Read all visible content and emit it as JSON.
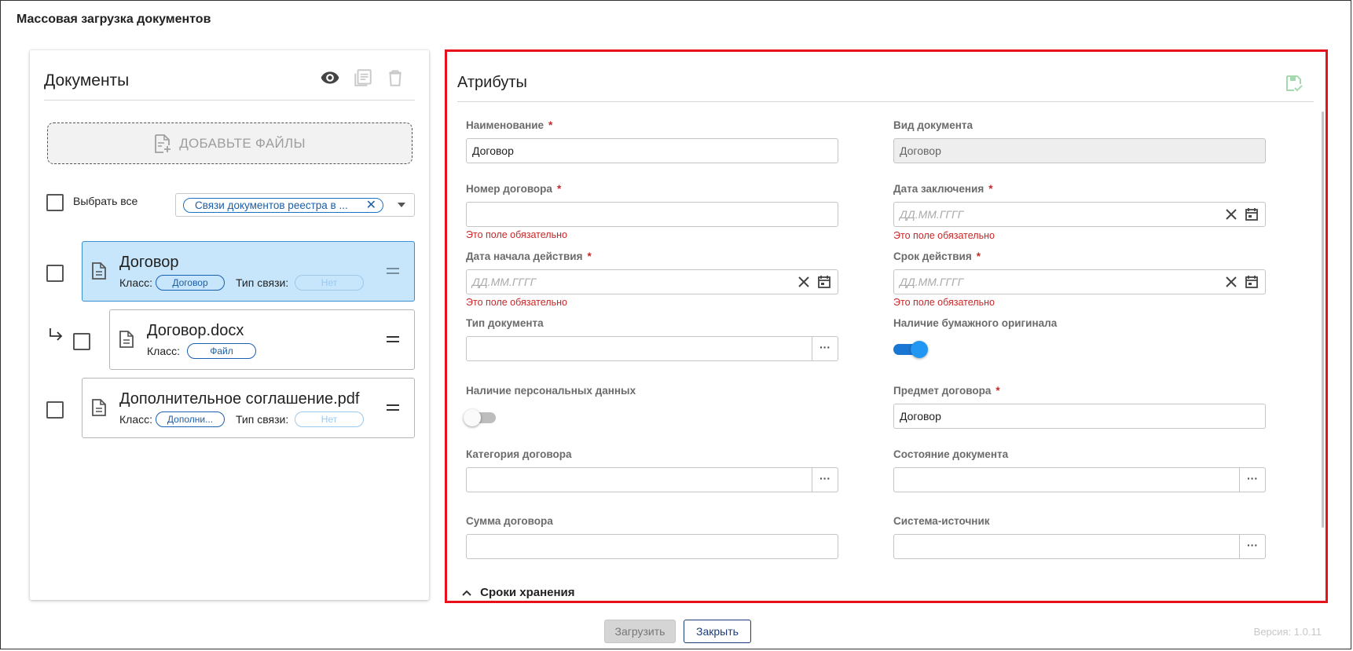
{
  "window": {
    "title": "Массовая загрузка документов"
  },
  "documents": {
    "title": "Документы",
    "add_files_label": "ДОБАВЬТЕ ФАЙЛЫ",
    "select_all_label": "Выбрать все",
    "filter_chip": "Связи документов реестра в ...",
    "items": [
      {
        "name": "Договор",
        "class_label": "Класс:",
        "class_value": "Договор",
        "link_label": "Тип связи:",
        "link_value": "Нет",
        "selected": true
      },
      {
        "name": "Договор.docx",
        "class_label": "Класс:",
        "class_value": "Файл"
      },
      {
        "name": "Дополнительное соглашение.pdf",
        "class_label": "Класс:",
        "class_value": "Дополни...",
        "link_label": "Тип связи:",
        "link_value": "Нет"
      }
    ]
  },
  "attributes": {
    "title": "Атрибуты",
    "required_mark": "*",
    "fields": {
      "name": {
        "label": "Наименование",
        "value": "Договор"
      },
      "doc_kind": {
        "label": "Вид документа",
        "value": "Договор"
      },
      "contract_number": {
        "label": "Номер договора",
        "value": "",
        "error": "Это поле обязательно"
      },
      "conclusion_date": {
        "label": "Дата заключения",
        "placeholder": "ДД.ММ.ГГГГ",
        "error": "Это поле обязательно"
      },
      "start_date": {
        "label": "Дата начала действия",
        "placeholder": "ДД.ММ.ГГГГ",
        "error": "Это поле обязательно"
      },
      "term": {
        "label": "Срок действия",
        "placeholder": "ДД.ММ.ГГГГ",
        "error": "Это поле обязательно"
      },
      "doc_type": {
        "label": "Тип документа",
        "value": ""
      },
      "paper_original": {
        "label": "Наличие бумажного оригинала",
        "on": true
      },
      "personal_data": {
        "label": "Наличие персональных данных",
        "on": false
      },
      "subject": {
        "label": "Предмет договора",
        "value": "Договор"
      },
      "category": {
        "label": "Категория договора",
        "value": ""
      },
      "doc_state": {
        "label": "Состояние документа",
        "value": ""
      },
      "amount": {
        "label": "Сумма договора",
        "value": ""
      },
      "source_system": {
        "label": "Система-источник",
        "value": ""
      }
    },
    "dots_label": "···",
    "section_storage": "Сроки хранения"
  },
  "footer": {
    "load_label": "Загрузить",
    "close_label": "Закрыть",
    "version": "Версия: 1.0.11"
  },
  "colors": {
    "accent": "#1a73c6",
    "error": "#c62828",
    "selected_card": "#c7e6fb",
    "highlight_border": "#e8101a",
    "toggle_on": "#1976d2"
  }
}
